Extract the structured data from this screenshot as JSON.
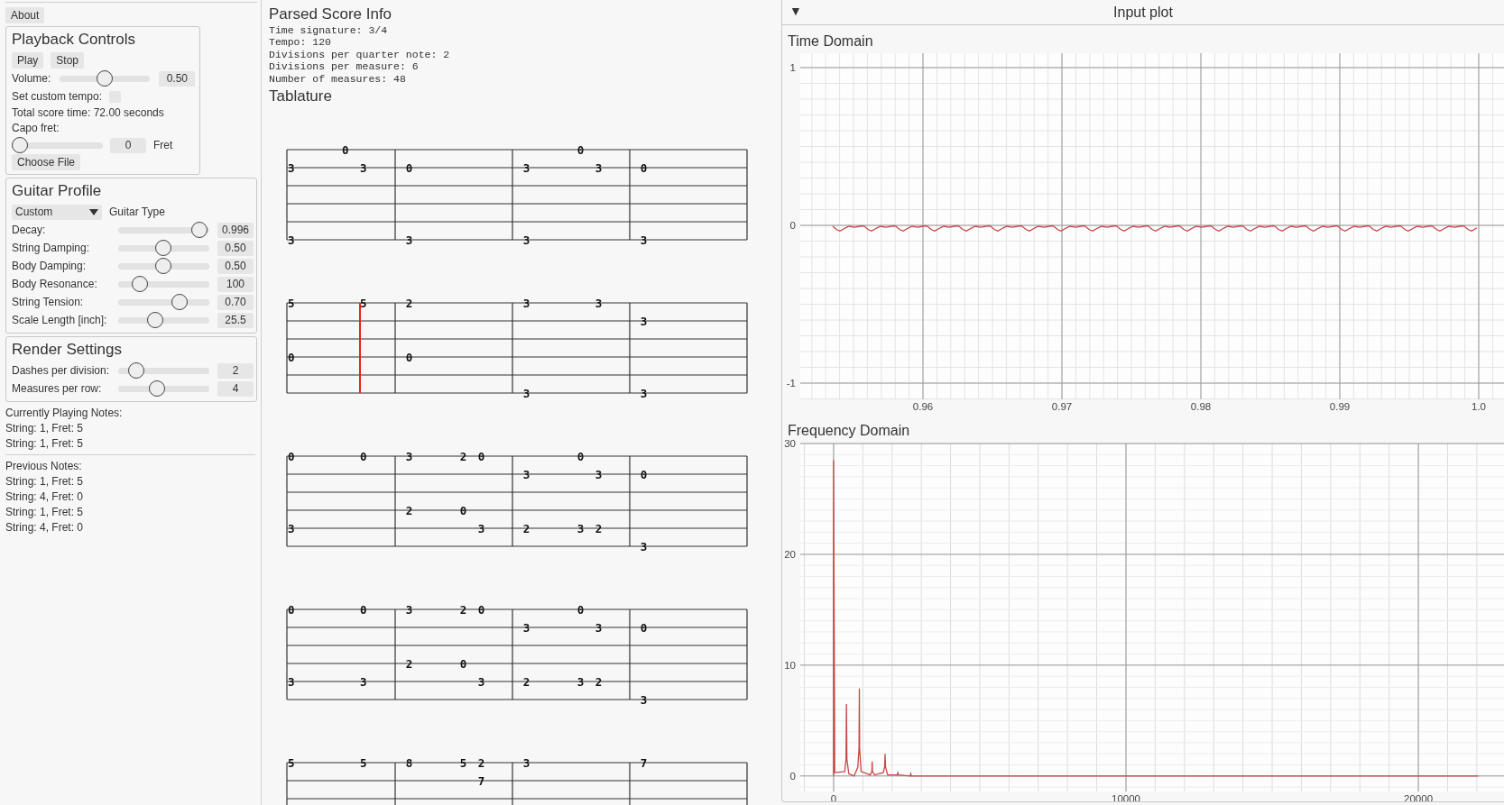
{
  "menu": {
    "about": "About"
  },
  "playback": {
    "title": "Playback Controls",
    "buttons": [
      "Play",
      "Stop"
    ],
    "volume": {
      "label": "Volume:",
      "level": 0.5,
      "value": "0.50"
    },
    "custom_tempo": {
      "label": "Set custom tempo:",
      "checked": false
    },
    "total_time": "Total score time: 72.00 seconds",
    "capo": {
      "label": "Capo fret:",
      "level": 0,
      "value": "0",
      "unit": "Fret"
    },
    "choose_file": "Choose File"
  },
  "guitar_profile": {
    "title": "Guitar Profile",
    "guitar_type": {
      "value": "Custom",
      "label": "Guitar Type"
    },
    "sliders": [
      {
        "label": "Decay:",
        "level": 0.98,
        "value": "0.996"
      },
      {
        "label": "String Damping:",
        "level": 0.49,
        "value": "0.50"
      },
      {
        "label": "Body Damping:",
        "level": 0.49,
        "value": "0.50"
      },
      {
        "label": "Body Resonance:",
        "level": 0.18,
        "value": "100"
      },
      {
        "label": "String Tension:",
        "level": 0.71,
        "value": "0.70"
      },
      {
        "label": "Scale Length [inch]:",
        "level": 0.39,
        "value": "25.5"
      }
    ]
  },
  "render_settings": {
    "title": "Render Settings",
    "sliders": [
      {
        "label": "Dashes per division:",
        "level": 0.13,
        "value": "2"
      },
      {
        "label": "Measures per row:",
        "level": 0.41,
        "value": "4"
      }
    ]
  },
  "currently_playing": {
    "title": "Currently Playing Notes:",
    "notes": [
      "String: 1, Fret: 5",
      "String: 1, Fret: 5"
    ]
  },
  "previous": {
    "title": "Previous Notes:",
    "notes": [
      "String: 1, Fret: 5",
      "String: 4, Fret: 0",
      "String: 1, Fret: 5",
      "String: 4, Fret: 0"
    ]
  },
  "score_info": {
    "title": "Parsed Score Info",
    "lines": [
      "Time signature: 3/4",
      "Tempo: 120",
      "Divisions per quarter note: 2",
      "Divisions per measure: 6",
      "Number of measures: 48"
    ]
  },
  "tablature": {
    "title": "Tablature",
    "staves": [
      {
        "measures": [
          {
            "string_1": {
              "division_4": "0"
            },
            "string_2": {
              "division_1": "3",
              "division_5": "3"
            },
            "string_6": {
              "division_1": "3"
            }
          },
          {
            "string_2": {
              "division_1": "0"
            },
            "string_6": {
              "division_1": "3"
            }
          },
          {
            "string_1": {
              "division_4": "0"
            },
            "string_2": {
              "division_1": "3",
              "division_5": "3"
            },
            "string_6": {
              "division_1": "3"
            }
          },
          {
            "string_2": {
              "division_1": "0"
            },
            "string_6": {
              "division_1": "3"
            }
          }
        ]
      },
      {
        "measures": [
          {
            "playhead": {
              "division_5": true
            },
            "string_1": {
              "division_1": "5",
              "division_5": "5"
            },
            "string_4": {
              "division_1": "0"
            }
          },
          {
            "string_1": {
              "division_1": "2"
            },
            "string_4": {
              "division_1": "0"
            }
          },
          {
            "string_1": {
              "division_1": "3",
              "division_5": "3"
            },
            "string_6": {
              "division_1": "3"
            }
          },
          {
            "string_2": {
              "division_1": "3"
            },
            "string_6": {
              "division_1": "3"
            }
          }
        ]
      },
      {
        "measures": [
          {
            "string_1": {
              "division_1": "0",
              "division_5": "0"
            },
            "string_5": {
              "division_1": "3"
            }
          },
          {
            "string_1": {
              "division_1": "3",
              "division_4": "2",
              "division_5": "0"
            },
            "string_4": {
              "division_1": "2",
              "division_4": "0"
            },
            "string_5": {
              "division_5": "3"
            }
          },
          {
            "string_1": {
              "division_4": "0"
            },
            "string_2": {
              "division_1": "3",
              "division_5": "3"
            },
            "string_5": {
              "division_1": "2",
              "division_4": "3",
              "division_5": "2"
            }
          },
          {
            "string_2": {
              "division_1": "0"
            },
            "string_6": {
              "division_1": "3"
            }
          }
        ]
      },
      {
        "measures": [
          {
            "string_1": {
              "division_1": "0",
              "division_5": "0"
            },
            "string_5": {
              "division_1": "3",
              "division_5": "3"
            }
          },
          {
            "string_1": {
              "division_1": "3",
              "division_4": "2",
              "division_5": "0"
            },
            "string_4": {
              "division_1": "2",
              "division_4": "0"
            },
            "string_5": {
              "division_5": "3"
            }
          },
          {
            "string_1": {
              "division_4": "0"
            },
            "string_2": {
              "division_1": "3",
              "division_5": "3"
            },
            "string_5": {
              "division_1": "2",
              "division_4": "3",
              "division_5": "2"
            }
          },
          {
            "string_2": {
              "division_1": "0"
            },
            "string_6": {
              "division_1": "3"
            }
          }
        ]
      },
      {
        "measures": [
          {
            "string_1": {
              "division_1": "5",
              "division_5": "5"
            }
          },
          {
            "string_1": {
              "division_1": "8",
              "division_4": "5",
              "division_5": "2"
            },
            "string_2": {
              "division_5": "7"
            }
          },
          {
            "string_1": {
              "division_1": "3"
            }
          },
          {
            "string_1": {
              "division_1": "7"
            }
          }
        ]
      }
    ]
  },
  "input_plot": {
    "title": "Input plot",
    "collapse_icon": "▼",
    "time_domain": {
      "title": "Time Domain",
      "y_tick_labels": [
        "1",
        "0",
        "-1"
      ],
      "x_tick_labels": [
        "0.96",
        "0.97",
        "0.98",
        "0.99",
        "1.0"
      ]
    },
    "frequency_domain": {
      "title": "Frequency Domain",
      "chart_data": {
        "type": "line",
        "grid": true,
        "xlim": [
          -1140,
          22960
        ],
        "ylim": [
          -1.4,
          30
        ],
        "xticks": [
          0,
          10000,
          20000
        ],
        "yticks": [
          0,
          10,
          20,
          30
        ],
        "x": [
          0,
          0,
          40,
          380,
          425,
          440,
          455,
          520,
          700,
          830,
          870,
          880,
          890,
          940,
          1250,
          1310,
          1320,
          1330,
          1400,
          1700,
          1745,
          1760,
          1775,
          1850,
          2180,
          2200,
          2220,
          2620,
          2640,
          2660,
          3000,
          22050
        ],
        "series": [
          {
            "color": "#c84646",
            "values": [
              0,
              28.5,
              0.3,
              0.4,
              1.5,
              6.5,
              1.5,
              0.2,
              0,
              0.8,
              2.5,
              7.9,
              2.5,
              0.4,
              0.1,
              0.4,
              1.3,
              0.4,
              0.1,
              0.3,
              0.8,
              2,
              0.8,
              0.1,
              0.1,
              0.3,
              0.1,
              0,
              0.2,
              0,
              0,
              0
            ]
          }
        ]
      }
    }
  }
}
